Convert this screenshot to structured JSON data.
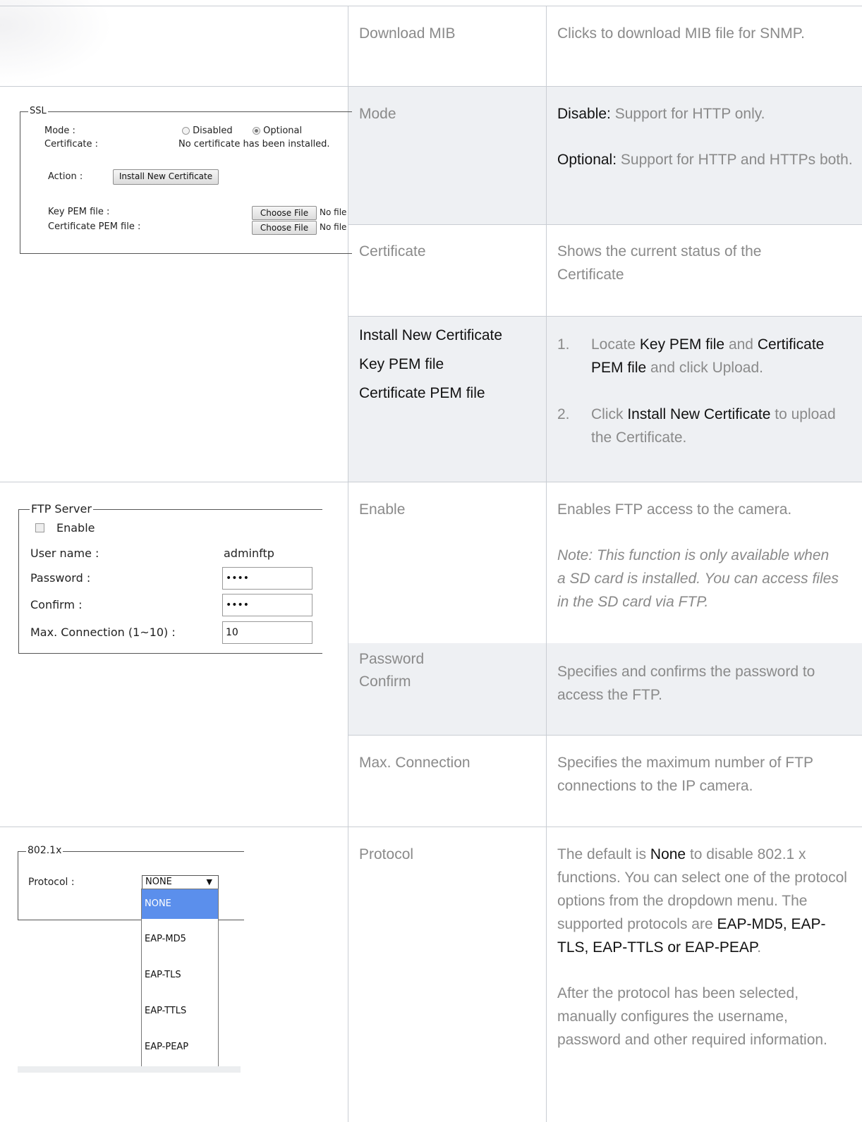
{
  "rows": {
    "download_mib": {
      "field": "Download MIB",
      "desc": "Clicks to download MIB file for SNMP."
    },
    "mode": {
      "field": "Mode",
      "disable_term": "Disable:",
      "disable_text": " Support for HTTP only.",
      "optional_term": "Optional:",
      "optional_text": " Support for HTTP and HTTPs both."
    },
    "certificate": {
      "field": "Certificate",
      "desc": "Shows the current status of the Certificate"
    },
    "install": {
      "field_lines": [
        "Install New Certificate",
        "Key PEM file",
        "Certificate PEM file"
      ],
      "step1_num": "1.",
      "step1_a": "Locate ",
      "step1_b": "Key PEM file",
      "step1_c": " and ",
      "step1_d": "Certificate PEM file",
      "step1_e": " and click Upload.",
      "step2_num": "2.",
      "step2_a": "Click ",
      "step2_b": "Install New Certificate",
      "step2_c": " to upload the Certificate."
    },
    "enable": {
      "field": "Enable",
      "desc": "Enables FTP access to the camera.",
      "note": "Note: This function is only available when a SD card is installed. You can access files in the SD card via FTP."
    },
    "password": {
      "field_line1": "Password",
      "field_line2": "Confirm",
      "desc": "Specifies and confirms the password to access the FTP."
    },
    "max_connection": {
      "field": "Max. Connection",
      "desc": "Specifies the maximum number of FTP connections to the IP camera."
    },
    "protocol": {
      "field": "Protocol",
      "d1": "The default is ",
      "d2": "None",
      "d3": " to disable 802.1 x functions. You can select one of the protocol options from the dropdown menu. The supported protocols are ",
      "d4": "EAP-MD5, EAP-TLS, EAP-TTLS or EAP-PEAP",
      "d5": ".",
      "p2": "After the protocol has been selected, manually configures the username, password and other required information."
    }
  },
  "ssl_panel": {
    "legend": "SSL",
    "mode_label": "Mode :",
    "opt_disabled": "Disabled",
    "opt_optional": "Optional",
    "cert_label": "Certificate :",
    "cert_status": "No certificate has been installed.",
    "action_label": "Action :",
    "install_button": "Install New Certificate",
    "key_pem_label": "Key PEM file :",
    "cert_pem_label": "Certificate PEM file :",
    "choose_file": "Choose File",
    "no_file": "No file"
  },
  "ftp_panel": {
    "legend": "FTP Server",
    "enable_label": "Enable",
    "user_label": "User name :",
    "user_value": "adminftp",
    "password_label": "Password :",
    "password_value": "••••",
    "confirm_label": "Confirm :",
    "confirm_value": "••••",
    "maxconn_label": "Max. Connection (1~10) :",
    "maxconn_value": "10"
  },
  "dot1x_panel": {
    "legend": "802.1x",
    "protocol_label": "Protocol :",
    "selected": "NONE",
    "options": [
      "NONE",
      "EAP-MD5",
      "EAP-TLS",
      "EAP-TTLS",
      "EAP-PEAP"
    ]
  },
  "colors": {
    "highlight": "#5b8fec",
    "row_shade": "#eef0f3",
    "grid": "#c9cdd3"
  }
}
